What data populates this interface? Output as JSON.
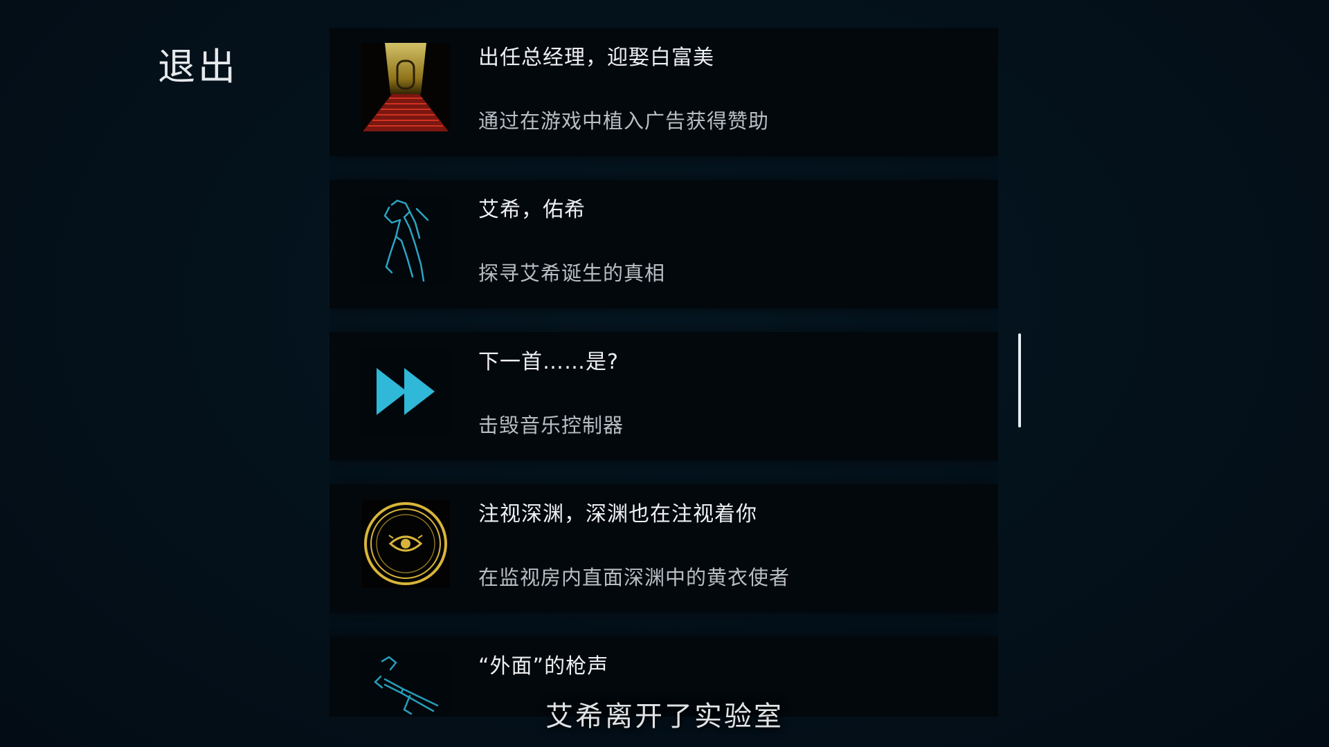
{
  "header": {
    "exit_label": "退出"
  },
  "achievements": [
    {
      "title": "出任总经理，迎娶白富美",
      "description": "通过在游戏中植入广告获得赞助",
      "icon": "golden-door-stairs-icon"
    },
    {
      "title": "艾希，佑希",
      "description": "探寻艾希诞生的真相",
      "icon": "robot-figure-icon"
    },
    {
      "title": "下一首……是?",
      "description": "击毁音乐控制器",
      "icon": "fast-forward-icon"
    },
    {
      "title": "注视深渊，深渊也在注视着你",
      "description": "在监视房内直面深渊中的黄衣使者",
      "icon": "eye-emblem-icon"
    },
    {
      "title": "“外面”的枪声",
      "description": "",
      "icon": "gun-icon"
    }
  ],
  "subtitle": "艾希离开了实验室",
  "colors": {
    "background": "#04101a",
    "card": "#03080d",
    "accent_cyan": "#2fb8d8",
    "accent_gold": "#d8b53a",
    "accent_red": "#c2281e"
  }
}
